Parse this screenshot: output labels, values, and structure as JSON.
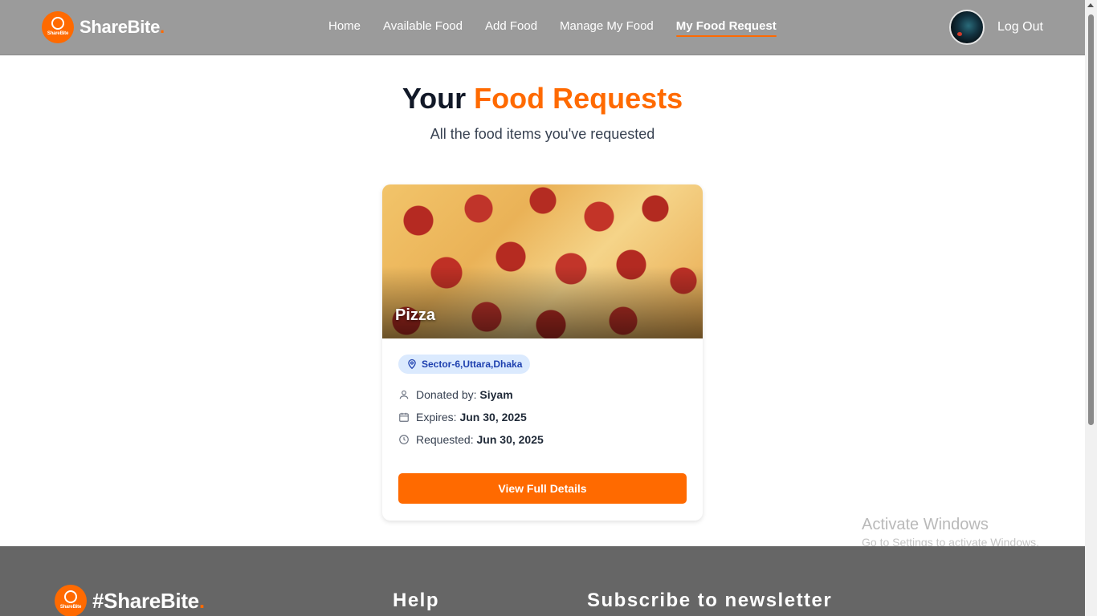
{
  "navbar": {
    "brand": "ShareBite",
    "brand_dot": ".",
    "logo_text": "ShareBite",
    "links": [
      {
        "label": "Home"
      },
      {
        "label": "Available Food"
      },
      {
        "label": "Add Food"
      },
      {
        "label": "Manage My Food"
      },
      {
        "label": "My Food Request",
        "active": true
      }
    ],
    "logout_label": "Log Out"
  },
  "heading": {
    "title_plain": "Your",
    "title_accent": "Food Requests",
    "subtitle": "All the food items you've requested"
  },
  "requests": [
    {
      "food_name": "Pizza",
      "location": "Sector-6,Uttara,Dhaka",
      "donated_label": "Donated by:",
      "donor": "Siyam",
      "expires_label": "Expires:",
      "expires": "Jun 30, 2025",
      "requested_label": "Requested:",
      "requested": "Jun 30, 2025",
      "button_label": "View Full Details"
    }
  ],
  "footer": {
    "brand": "#ShareBite",
    "brand_dot": ".",
    "logo_text": "ShareBite",
    "help_heading": "Help",
    "newsletter_heading": "Subscribe to newsletter"
  },
  "watermark": {
    "title": "Activate Windows",
    "subtitle": "Go to Settings to activate Windows."
  },
  "colors": {
    "accent": "#ff6a00",
    "navbar_bg": "#9b9b9b",
    "footer_bg": "#666666",
    "badge_bg": "#dbeafe",
    "badge_text": "#1e40af"
  }
}
